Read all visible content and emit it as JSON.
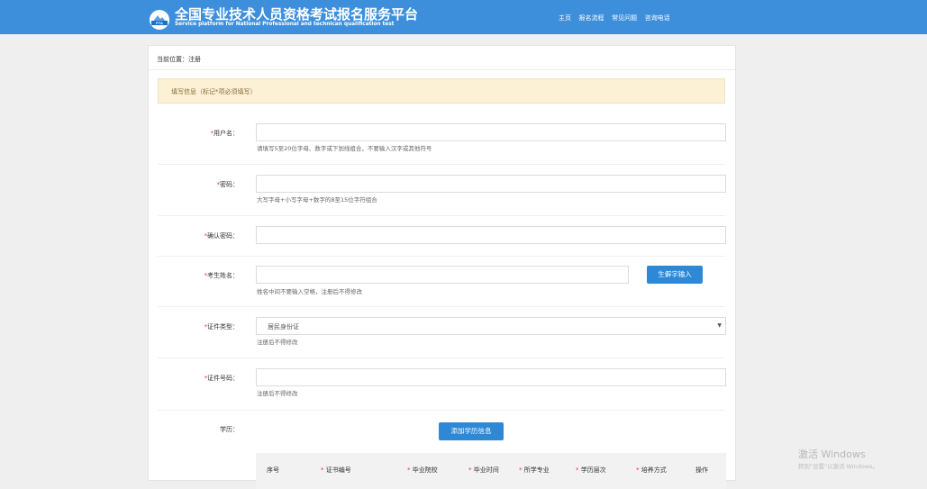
{
  "header": {
    "logo_text": "PTA",
    "title": "全国专业技术人员资格考试报名服务平台",
    "subtitle": "Service platform for National Professional and technican qualification test",
    "nav": [
      "主页",
      "报名流程",
      "常见问题",
      "咨询电话"
    ]
  },
  "breadcrumb": "当前位置：注册",
  "notice": "填写信息（标记*项必须填写）",
  "form": {
    "required_mark": "*",
    "username": {
      "label": "用户名：",
      "value": "",
      "hint": "请填写5至20位字母、数字或下划线组合，不要输入汉字或其他符号"
    },
    "password": {
      "label": "密码：",
      "value": "",
      "hint": "大写字母+小写字母+数字的8至15位字符组合"
    },
    "confirm_password": {
      "label": "确认密码：",
      "value": ""
    },
    "name": {
      "label": "考生姓名：",
      "value": "",
      "hint": "姓名中间不要输入空格，注册后不得修改",
      "button": "生僻字输入"
    },
    "id_type": {
      "label": "证件类型：",
      "value": "居民身份证",
      "hint": "注册后不得修改"
    },
    "id_number": {
      "label": "证件号码：",
      "value": "",
      "hint": "注册后不得修改"
    },
    "education": {
      "label": "学历：",
      "button": "添加学历信息",
      "columns": [
        {
          "text": "序号",
          "required": false
        },
        {
          "text": "证书编号",
          "required": true
        },
        {
          "text": "毕业院校",
          "required": true
        },
        {
          "text": "毕业时间",
          "required": true
        },
        {
          "text": "所学专业",
          "required": true
        },
        {
          "text": "学历层次",
          "required": true
        },
        {
          "text": "培养方式",
          "required": true
        },
        {
          "text": "操作",
          "required": false
        }
      ]
    }
  },
  "watermark": {
    "line1": "激活 Windows",
    "line2": "转到\"设置\"以激活 Windows。"
  }
}
